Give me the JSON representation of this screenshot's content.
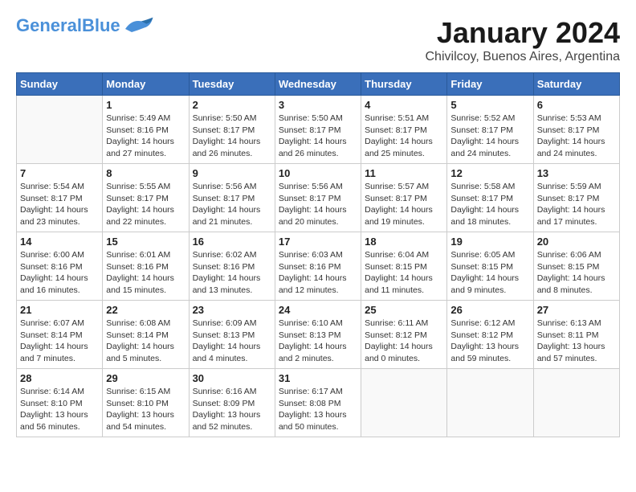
{
  "header": {
    "logo_general": "General",
    "logo_blue": "Blue",
    "month": "January 2024",
    "location": "Chivilcoy, Buenos Aires, Argentina"
  },
  "weekdays": [
    "Sunday",
    "Monday",
    "Tuesday",
    "Wednesday",
    "Thursday",
    "Friday",
    "Saturday"
  ],
  "weeks": [
    [
      {
        "day": "",
        "info": ""
      },
      {
        "day": "1",
        "info": "Sunrise: 5:49 AM\nSunset: 8:16 PM\nDaylight: 14 hours\nand 27 minutes."
      },
      {
        "day": "2",
        "info": "Sunrise: 5:50 AM\nSunset: 8:17 PM\nDaylight: 14 hours\nand 26 minutes."
      },
      {
        "day": "3",
        "info": "Sunrise: 5:50 AM\nSunset: 8:17 PM\nDaylight: 14 hours\nand 26 minutes."
      },
      {
        "day": "4",
        "info": "Sunrise: 5:51 AM\nSunset: 8:17 PM\nDaylight: 14 hours\nand 25 minutes."
      },
      {
        "day": "5",
        "info": "Sunrise: 5:52 AM\nSunset: 8:17 PM\nDaylight: 14 hours\nand 24 minutes."
      },
      {
        "day": "6",
        "info": "Sunrise: 5:53 AM\nSunset: 8:17 PM\nDaylight: 14 hours\nand 24 minutes."
      }
    ],
    [
      {
        "day": "7",
        "info": "Sunrise: 5:54 AM\nSunset: 8:17 PM\nDaylight: 14 hours\nand 23 minutes."
      },
      {
        "day": "8",
        "info": "Sunrise: 5:55 AM\nSunset: 8:17 PM\nDaylight: 14 hours\nand 22 minutes."
      },
      {
        "day": "9",
        "info": "Sunrise: 5:56 AM\nSunset: 8:17 PM\nDaylight: 14 hours\nand 21 minutes."
      },
      {
        "day": "10",
        "info": "Sunrise: 5:56 AM\nSunset: 8:17 PM\nDaylight: 14 hours\nand 20 minutes."
      },
      {
        "day": "11",
        "info": "Sunrise: 5:57 AM\nSunset: 8:17 PM\nDaylight: 14 hours\nand 19 minutes."
      },
      {
        "day": "12",
        "info": "Sunrise: 5:58 AM\nSunset: 8:17 PM\nDaylight: 14 hours\nand 18 minutes."
      },
      {
        "day": "13",
        "info": "Sunrise: 5:59 AM\nSunset: 8:17 PM\nDaylight: 14 hours\nand 17 minutes."
      }
    ],
    [
      {
        "day": "14",
        "info": "Sunrise: 6:00 AM\nSunset: 8:16 PM\nDaylight: 14 hours\nand 16 minutes."
      },
      {
        "day": "15",
        "info": "Sunrise: 6:01 AM\nSunset: 8:16 PM\nDaylight: 14 hours\nand 15 minutes."
      },
      {
        "day": "16",
        "info": "Sunrise: 6:02 AM\nSunset: 8:16 PM\nDaylight: 14 hours\nand 13 minutes."
      },
      {
        "day": "17",
        "info": "Sunrise: 6:03 AM\nSunset: 8:16 PM\nDaylight: 14 hours\nand 12 minutes."
      },
      {
        "day": "18",
        "info": "Sunrise: 6:04 AM\nSunset: 8:15 PM\nDaylight: 14 hours\nand 11 minutes."
      },
      {
        "day": "19",
        "info": "Sunrise: 6:05 AM\nSunset: 8:15 PM\nDaylight: 14 hours\nand 9 minutes."
      },
      {
        "day": "20",
        "info": "Sunrise: 6:06 AM\nSunset: 8:15 PM\nDaylight: 14 hours\nand 8 minutes."
      }
    ],
    [
      {
        "day": "21",
        "info": "Sunrise: 6:07 AM\nSunset: 8:14 PM\nDaylight: 14 hours\nand 7 minutes."
      },
      {
        "day": "22",
        "info": "Sunrise: 6:08 AM\nSunset: 8:14 PM\nDaylight: 14 hours\nand 5 minutes."
      },
      {
        "day": "23",
        "info": "Sunrise: 6:09 AM\nSunset: 8:13 PM\nDaylight: 14 hours\nand 4 minutes."
      },
      {
        "day": "24",
        "info": "Sunrise: 6:10 AM\nSunset: 8:13 PM\nDaylight: 14 hours\nand 2 minutes."
      },
      {
        "day": "25",
        "info": "Sunrise: 6:11 AM\nSunset: 8:12 PM\nDaylight: 14 hours\nand 0 minutes."
      },
      {
        "day": "26",
        "info": "Sunrise: 6:12 AM\nSunset: 8:12 PM\nDaylight: 13 hours\nand 59 minutes."
      },
      {
        "day": "27",
        "info": "Sunrise: 6:13 AM\nSunset: 8:11 PM\nDaylight: 13 hours\nand 57 minutes."
      }
    ],
    [
      {
        "day": "28",
        "info": "Sunrise: 6:14 AM\nSunset: 8:10 PM\nDaylight: 13 hours\nand 56 minutes."
      },
      {
        "day": "29",
        "info": "Sunrise: 6:15 AM\nSunset: 8:10 PM\nDaylight: 13 hours\nand 54 minutes."
      },
      {
        "day": "30",
        "info": "Sunrise: 6:16 AM\nSunset: 8:09 PM\nDaylight: 13 hours\nand 52 minutes."
      },
      {
        "day": "31",
        "info": "Sunrise: 6:17 AM\nSunset: 8:08 PM\nDaylight: 13 hours\nand 50 minutes."
      },
      {
        "day": "",
        "info": ""
      },
      {
        "day": "",
        "info": ""
      },
      {
        "day": "",
        "info": ""
      }
    ]
  ]
}
